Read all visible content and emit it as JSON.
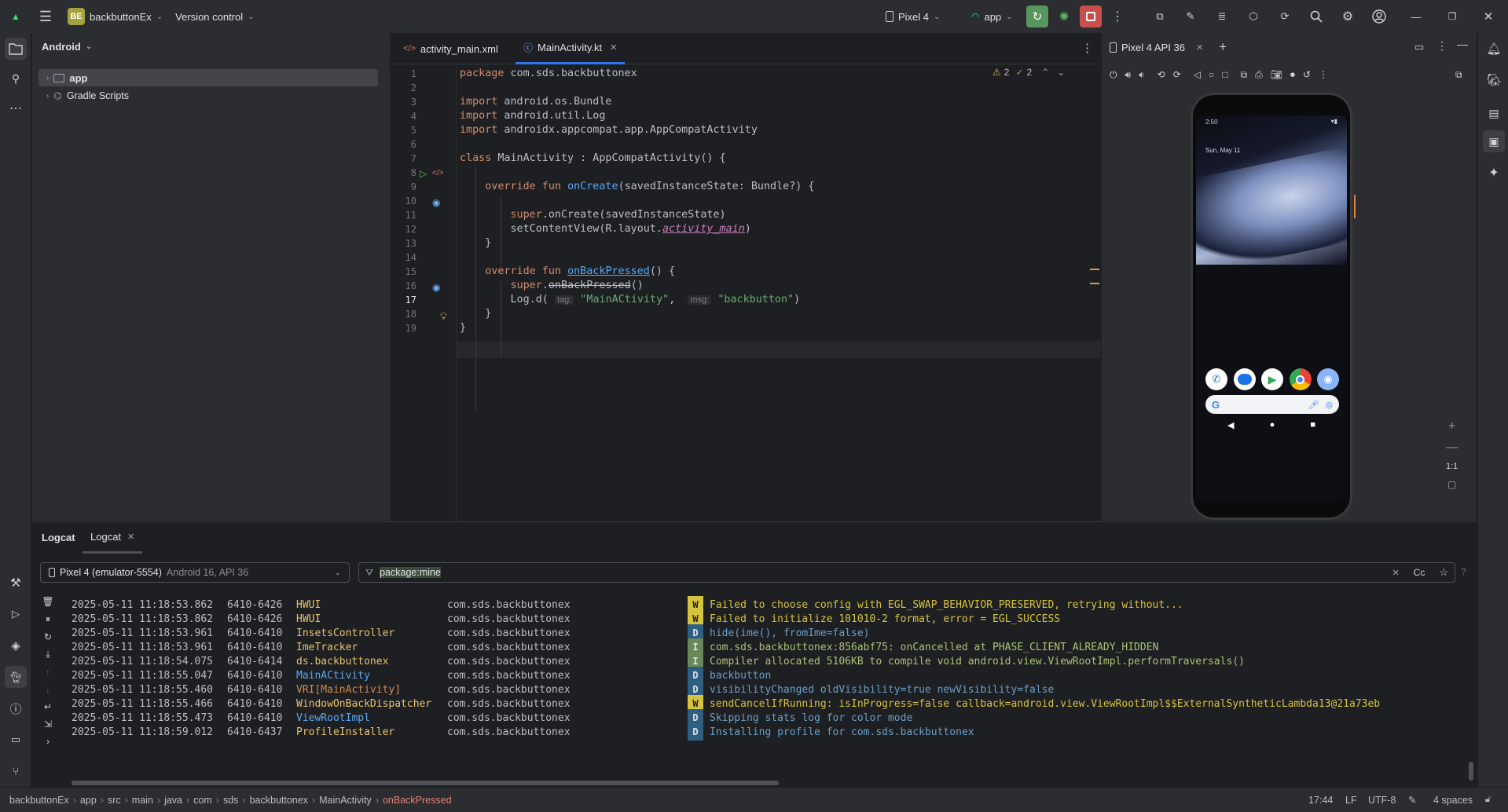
{
  "colors": {
    "accent": "#3574f0",
    "warn_level": "#dcb33a",
    "info_level": "#6a8759",
    "debug_level": "#2e5f83",
    "run_green": "#57965c",
    "stop_red": "#c94f4f"
  },
  "titlebar": {
    "project_badge": "BE",
    "project_name": "backbuttonEx",
    "vcs_label": "Version control",
    "device_selector": "Pixel 4",
    "run_config": "app"
  },
  "project_panel": {
    "view_mode": "Android",
    "items": [
      {
        "label": "app"
      },
      {
        "label": "Gradle Scripts"
      }
    ]
  },
  "editor": {
    "tabs": [
      {
        "label": "activity_main.xml"
      },
      {
        "label": "MainActivity.kt"
      }
    ],
    "warnings_count": "2",
    "weak_warnings_count": "2",
    "current_line": "17",
    "lines": [
      {
        "n": "1",
        "text": "package com.sds.backbuttonex"
      },
      {
        "n": "2",
        "text": ""
      },
      {
        "n": "3",
        "text": "import android.os.Bundle"
      },
      {
        "n": "4",
        "text": "import android.util.Log"
      },
      {
        "n": "5",
        "text": "import androidx.appcompat.app.AppCompatActivity"
      },
      {
        "n": "6",
        "text": ""
      },
      {
        "n": "7",
        "text": "class MainActivity : AppCompatActivity() {"
      },
      {
        "n": "8",
        "text": ""
      },
      {
        "n": "9",
        "text": "    override fun onCreate(savedInstanceState: Bundle?) {"
      },
      {
        "n": "10",
        "text": ""
      },
      {
        "n": "11",
        "text": "        super.onCreate(savedInstanceState)"
      },
      {
        "n": "12",
        "text": "        setContentView(R.layout.activity_main)"
      },
      {
        "n": "13",
        "text": "    }"
      },
      {
        "n": "14",
        "text": ""
      },
      {
        "n": "15",
        "text": "    override fun onBackPressed() {"
      },
      {
        "n": "16",
        "text": "        super.onBackPressed()"
      },
      {
        "n": "17",
        "text": "        Log.d( tag: \"MainACtivity\",  msg: \"backbutton\")"
      },
      {
        "n": "18",
        "text": "    }"
      },
      {
        "n": "19",
        "text": "}"
      }
    ],
    "hint_tag": "tag:",
    "hint_msg": "msg:"
  },
  "emulator": {
    "tab_label": "Pixel 4 API 36",
    "zoom_label": "1:1",
    "status_time": "2:50",
    "date_text": "Sun, May 11"
  },
  "logcat": {
    "tab_main": "Logcat",
    "tab_sub": "Logcat",
    "device": "Pixel 4 (emulator-5554)",
    "device_sub": "Android 16, API 36",
    "filter": "package:mine",
    "case_label": "Cc",
    "rows": [
      {
        "time": "2025-05-11 11:18:53.862",
        "pid": "6410-6426",
        "tag": "HWUI",
        "pkg": "com.sds.backbuttonex",
        "level": "W",
        "msg": "Failed to choose config with EGL_SWAP_BEHAVIOR_PRESERVED, retrying without..."
      },
      {
        "time": "2025-05-11 11:18:53.862",
        "pid": "6410-6426",
        "tag": "HWUI",
        "pkg": "com.sds.backbuttonex",
        "level": "W",
        "msg": "Failed to initialize 101010-2 format, error = EGL_SUCCESS"
      },
      {
        "time": "2025-05-11 11:18:53.961",
        "pid": "6410-6410",
        "tag": "InsetsController",
        "pkg": "com.sds.backbuttonex",
        "level": "D",
        "msg": "hide(ime(), fromIme=false)"
      },
      {
        "time": "2025-05-11 11:18:53.961",
        "pid": "6410-6410",
        "tag": "ImeTracker",
        "pkg": "com.sds.backbuttonex",
        "level": "I",
        "msg": "com.sds.backbuttonex:856abf75: onCancelled at PHASE_CLIENT_ALREADY_HIDDEN"
      },
      {
        "time": "2025-05-11 11:18:54.075",
        "pid": "6410-6414",
        "tag": "ds.backbuttonex",
        "pkg": "com.sds.backbuttonex",
        "level": "I",
        "msg": "Compiler allocated 5106KB to compile void android.view.ViewRootImpl.performTraversals()"
      },
      {
        "time": "2025-05-11 11:18:55.047",
        "pid": "6410-6410",
        "tag": "MainACtivity",
        "pkg": "com.sds.backbuttonex",
        "level": "D",
        "msg": "backbutton"
      },
      {
        "time": "2025-05-11 11:18:55.460",
        "pid": "6410-6410",
        "tag": "VRI[MainActivity]",
        "pkg": "com.sds.backbuttonex",
        "level": "D",
        "msg": "visibilityChanged oldVisibility=true newVisibility=false"
      },
      {
        "time": "2025-05-11 11:18:55.466",
        "pid": "6410-6410",
        "tag": "WindowOnBackDispatcher",
        "pkg": "com.sds.backbuttonex",
        "level": "W",
        "msg": "sendCancelIfRunning: isInProgress=false callback=android.view.ViewRootImpl$$ExternalSyntheticLambda13@21a73eb"
      },
      {
        "time": "2025-05-11 11:18:55.473",
        "pid": "6410-6410",
        "tag": "ViewRootImpl",
        "pkg": "com.sds.backbuttonex",
        "level": "D",
        "msg": "Skipping stats log for color mode"
      },
      {
        "time": "2025-05-11 11:18:59.012",
        "pid": "6410-6437",
        "tag": "ProfileInstaller",
        "pkg": "com.sds.backbuttonex",
        "level": "D",
        "msg": "Installing profile for com.sds.backbuttonex"
      }
    ]
  },
  "statusbar": {
    "breadcrumbs": [
      "backbuttonEx",
      "app",
      "src",
      "main",
      "java",
      "com",
      "sds",
      "backbuttonex",
      "MainActivity",
      "onBackPressed"
    ],
    "position": "17:44",
    "line_sep": "LF",
    "encoding": "UTF-8",
    "indent": "4 spaces"
  }
}
